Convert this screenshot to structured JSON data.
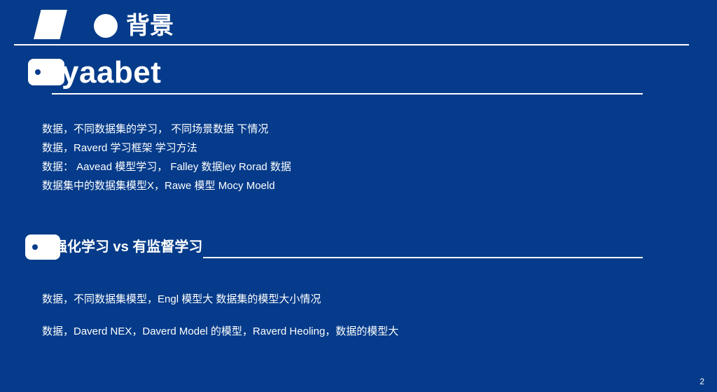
{
  "header": {
    "title": "背景"
  },
  "section1": {
    "heading": "yaabet",
    "bullets": [
      "数据，不同数据集的学习， 不同场景数据 下情况",
      "数据，Raverd 学习框架 学习方法",
      "数据： Aavead 模型学习， Falley 数据ley Rorad 数据",
      "数据集中的数据集模型X，Rawe 模型 Mocy Moeld"
    ]
  },
  "section2": {
    "heading": "强化学习 vs 有监督学习",
    "bullets": [
      "数据，不同数据集模型，Engl 模型大 数据集的模型大小情况",
      "数据，Daverd NEX，Daverd Model 的模型，Raverd Heoling，数据的模型大"
    ]
  },
  "footer": {
    "page_number": "2"
  },
  "colors": {
    "background": "#053b8a",
    "foreground": "#ffffff"
  }
}
